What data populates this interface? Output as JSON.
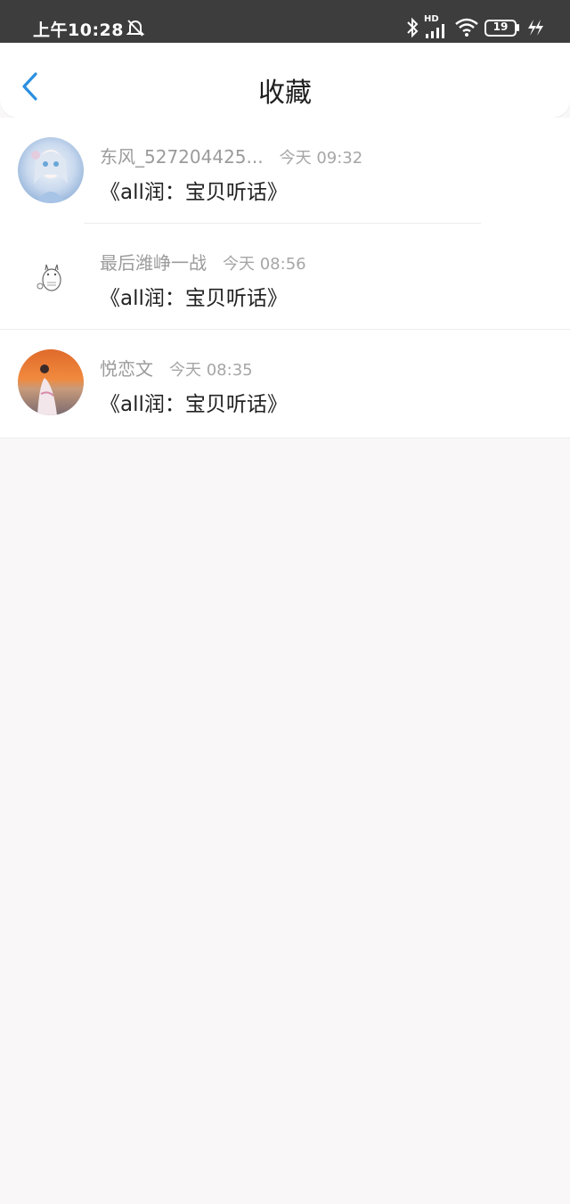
{
  "status_bar": {
    "time": "上午10:28",
    "signal_label": "HD",
    "battery_level": "19",
    "icons": [
      "mute-bell-icon",
      "bluetooth-icon",
      "hd-signal-icon",
      "wifi-icon",
      "battery-icon",
      "charging-icon"
    ]
  },
  "header": {
    "title": "收藏",
    "back_icon": "chevron-left-icon",
    "accent_color": "#2b8fe0"
  },
  "items": [
    {
      "author": "东风_527204425...",
      "time": "今天 09:32",
      "book_title": "《all润：宝贝听话》"
    },
    {
      "author": "最后潍峥一战",
      "time": "今天 08:56",
      "book_title": "《all润：宝贝听话》"
    },
    {
      "author": "悦恋文",
      "time": "今天 08:35",
      "book_title": "《all润：宝贝听话》"
    }
  ]
}
